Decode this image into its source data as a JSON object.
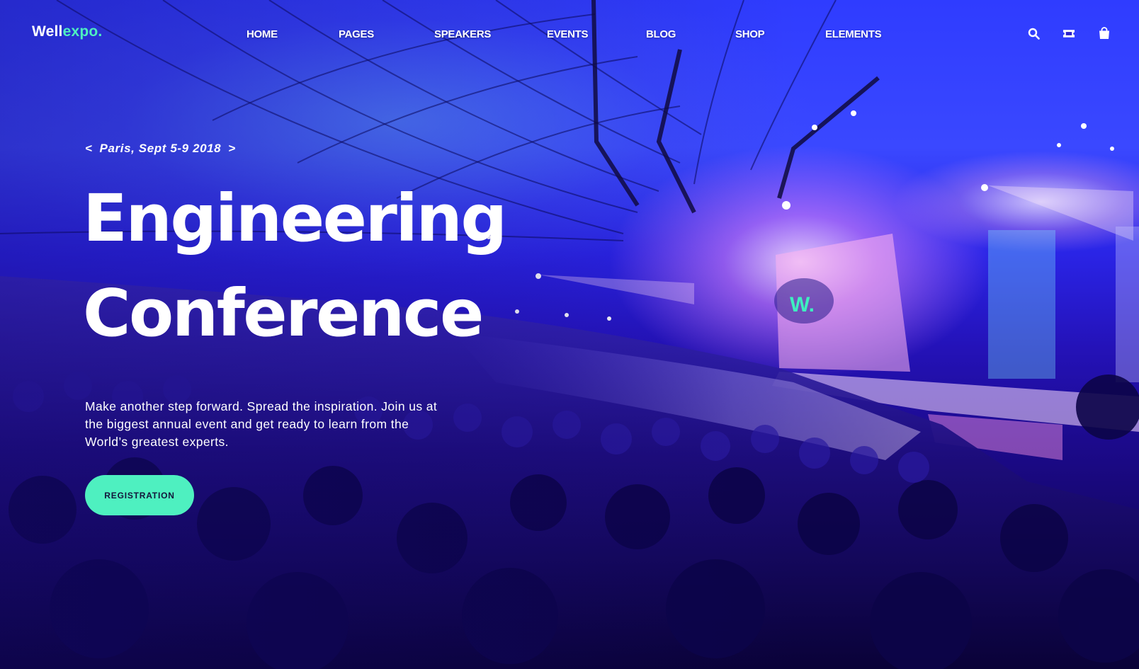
{
  "brand": {
    "name_part1": "Well",
    "name_part2": "expo.",
    "accent_color": "#4ef0c0"
  },
  "nav": {
    "items": [
      {
        "label": "HOME"
      },
      {
        "label": "PAGES"
      },
      {
        "label": "SPEAKERS"
      },
      {
        "label": "EVENTS"
      },
      {
        "label": "BLOG"
      },
      {
        "label": "SHOP"
      },
      {
        "label": "ELEMENTS"
      }
    ],
    "icons": [
      "search-icon",
      "ticket-icon",
      "shopping-bag-icon"
    ]
  },
  "hero": {
    "date_prefix": "<",
    "date": "Paris, Sept 5-9 2018",
    "date_suffix": ">",
    "title_line1": "Engineering",
    "title_line2": "Conference",
    "description": "Make another step forward. Spread the inspiration. Join us at the biggest annual event and get ready to learn from the World’s greatest experts.",
    "cta_label": "REGISTRATION",
    "stage_logo": "W."
  }
}
